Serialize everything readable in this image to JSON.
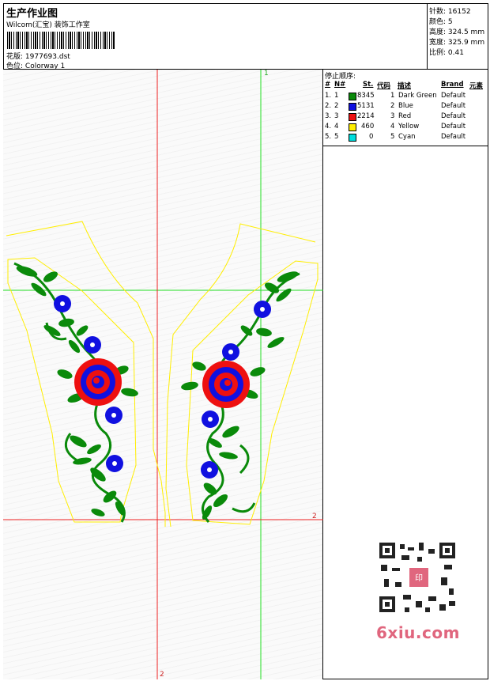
{
  "header": {
    "title": "生产作业图",
    "company": "Wilcom(汇宝) 装饰工作室",
    "design_label": "花版:",
    "design_value": "1977693.dst",
    "colorway_label": "色位:",
    "colorway_value": "Colorway 1"
  },
  "stats": [
    {
      "label": "针数:",
      "value": "16152"
    },
    {
      "label": "颜色:",
      "value": "5"
    },
    {
      "label": "高度:",
      "value": "324.5 mm"
    },
    {
      "label": "宽度:",
      "value": "325.9 mm"
    },
    {
      "label": "比例:",
      "value": "0.41"
    }
  ],
  "color_table": {
    "label": "停止顺序:",
    "columns": [
      "#",
      "N#",
      "St.",
      "代码",
      "描述",
      "Brand",
      "元素"
    ],
    "rows": [
      {
        "num": "1.",
        "n": "1",
        "stitches": "8345",
        "code": "1",
        "desc": "Dark Green",
        "brand": "Default",
        "color": "#0a8a0a"
      },
      {
        "num": "2.",
        "n": "2",
        "stitches": "5131",
        "code": "2",
        "desc": "Blue",
        "brand": "Default",
        "color": "#1010e0"
      },
      {
        "num": "3.",
        "n": "3",
        "stitches": "2214",
        "code": "3",
        "desc": "Red",
        "brand": "Default",
        "color": "#ee1010"
      },
      {
        "num": "4.",
        "n": "4",
        "stitches": "460",
        "code": "4",
        "desc": "Yellow",
        "brand": "Default",
        "color": "#ffee00"
      },
      {
        "num": "5.",
        "n": "5",
        "stitches": "0",
        "code": "5",
        "desc": "Cyan",
        "brand": "Default",
        "color": "#00dddd"
      }
    ]
  },
  "guides": {
    "green_label": "1",
    "red_label": "2"
  },
  "watermark": {
    "text": "6xiu.com",
    "stamp": "印"
  },
  "colors": {
    "guide_green": "#22dd22",
    "guide_red": "#ee2222",
    "outline": "#ffee00"
  }
}
